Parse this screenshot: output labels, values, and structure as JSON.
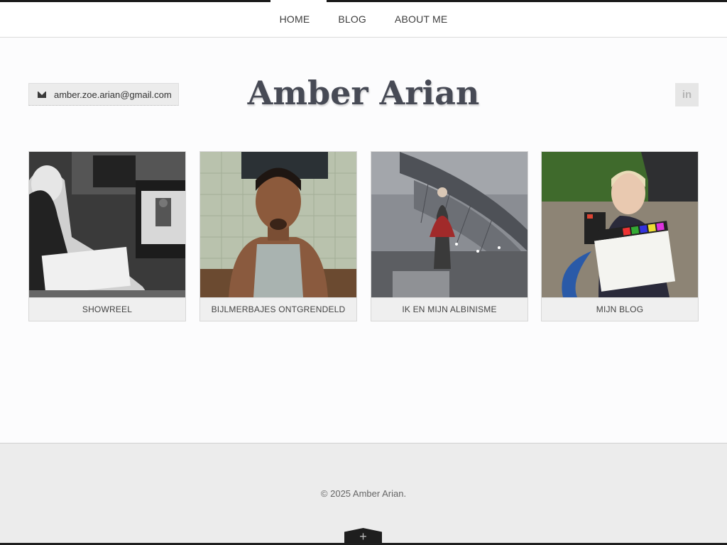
{
  "nav": {
    "items": [
      {
        "label": "HOME"
      },
      {
        "label": "BLOG"
      },
      {
        "label": "ABOUT ME"
      }
    ]
  },
  "header": {
    "email": "amber.zoe.arian@gmail.com",
    "title": "Amber Arian",
    "social": {
      "label": "in",
      "icon": "linkedin-icon"
    }
  },
  "cards": [
    {
      "caption": "SHOWREEL",
      "image": "director-monitor-photo"
    },
    {
      "caption": "BIJLMERBAJES ONTGRENDELD",
      "image": "man-portrait-photo"
    },
    {
      "caption": "IK EN MIJN ALBINISME",
      "image": "station-statue-photo"
    },
    {
      "caption": "MIJN BLOG",
      "image": "clapperboard-photo"
    }
  ],
  "footer": {
    "copyright": "© 2025 Amber Arian.",
    "toggle_icon": "plus-icon"
  },
  "colors": {
    "title": "#474a55",
    "topbar_border": "#1a1a1a",
    "footer_bg": "#ececec"
  }
}
